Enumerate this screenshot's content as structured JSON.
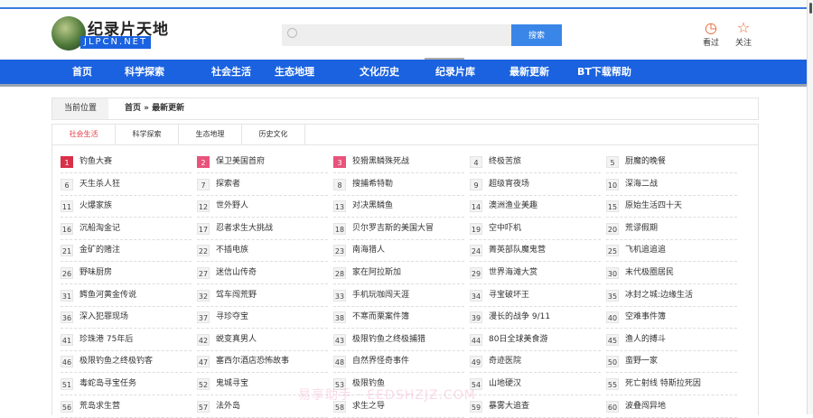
{
  "header": {
    "logo_cn": "纪录片天地",
    "logo_en": "JLPCN.NET",
    "search_placeholder": "",
    "search_button": "搜索",
    "history_label": "看过",
    "follow_label": "关注"
  },
  "nav": [
    "首页",
    "科学探索",
    "社会生活",
    "生态地理",
    "文化历史",
    "纪录片库",
    "最新更新",
    "BT下载帮助"
  ],
  "breadcrumb": {
    "label": "当前位置",
    "path": "首页 » 最新更新"
  },
  "tabs": [
    {
      "label": "社会生活",
      "active": true
    },
    {
      "label": "科学探索"
    },
    {
      "label": "生态地理"
    },
    {
      "label": "历史文化"
    }
  ],
  "colors": {
    "nav": "#1a62e0",
    "active_tab": "#e5404a",
    "rank_top": "#d9304a",
    "rank_hot": "#e8537a"
  },
  "items": [
    "钓鱼大赛",
    "保卫美国首府",
    "狡猾黑鳞殊死战",
    "终极苦旅",
    "厨魔的晚餐",
    "天生杀人狂",
    "探索者",
    "搜捕希特勒",
    "超级宵夜场",
    "深海二战",
    "火爆家族",
    "世外野人",
    "对决黑鳞鱼",
    "澳洲渔业美趣",
    "原始生活四十天",
    "沉船淘金记",
    "忍者求生大挑战",
    "贝尔罗吉斯的美国大冒",
    "空中吓机",
    "荒谬假期",
    "金矿的赌注",
    "不插电族",
    "南海猎人",
    "菁英部队魔鬼营",
    "飞机追追追",
    "野味厨房",
    "迷信山传奇",
    "家在阿拉斯加",
    "世界海滩大赏",
    "末代极圈居民",
    "鳄鱼河黄金传说",
    "驾车闯荒野",
    "手机玩咖闯天涯",
    "寻宝破坏王",
    "冰封之城:边缘生活",
    "深入犯罪现场",
    "寻珍夺宝",
    "不寒而栗案件簿",
    "漫长的战争 9/11",
    "空难事件簿",
    "珍珠港 75年后",
    "蜕变真男人",
    "极限钓鱼之终极捕猎",
    "80日全球美食游",
    "渔人的搏斗",
    "极限钓鱼之终极钓客",
    "塞西尔酒店恐怖故事",
    "自然界怪奇事件",
    "奇迹医院",
    "蛮野一家",
    "毒蛇岛寻宝任务",
    "鬼城寻宝",
    "极限钓鱼",
    "山地硬汉",
    "死亡射线 特斯拉死因",
    "荒岛求生营",
    "法外岛",
    "求生之导",
    "暴雾大追查",
    "波叠闯异地"
  ],
  "watermark": "易享助手 · EEDSHZJZ.COM"
}
